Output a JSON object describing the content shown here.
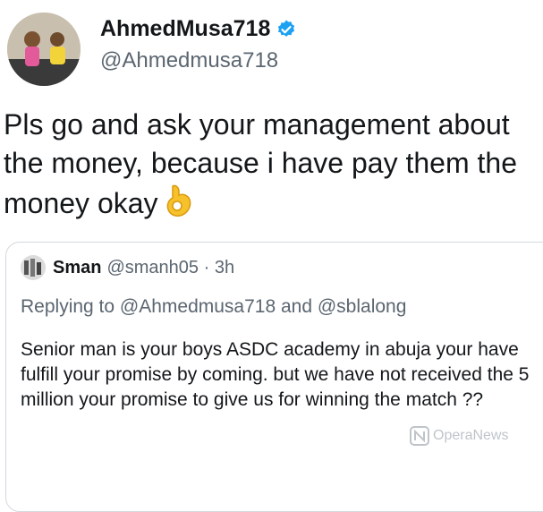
{
  "tweet": {
    "display_name": "AhmedMusa718",
    "handle": "@Ahmedmusa718",
    "text": "Pls go and ask your management about the money, because i have pay them the money okay",
    "emoji": "ok-hand-icon"
  },
  "quoted": {
    "name": "Sman",
    "handle_time": "@smanh05 · 3h",
    "replying": "Replying to @Ahmedmusa718 and @sblalong",
    "text": "Senior man is your boys ASDC academy in abuja your have fulfill your promise by coming. but we have not received the 5 million your promise to give us for winning the match ??"
  },
  "watermark": {
    "label": "OperaNews"
  },
  "colors": {
    "verified": "#1da1f2",
    "secondary_text": "#5b6670",
    "border": "#d3d9de"
  }
}
